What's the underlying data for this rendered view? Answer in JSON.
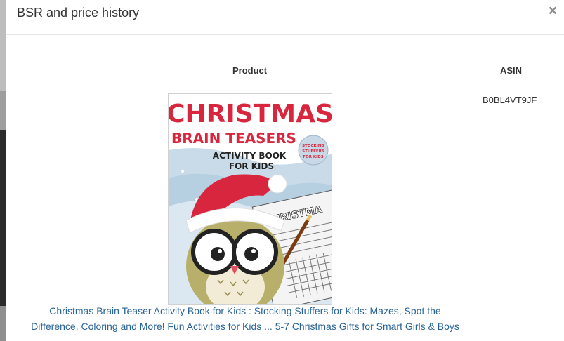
{
  "modal": {
    "title": "BSR and price history",
    "close_label": "×"
  },
  "table": {
    "headers": [
      "Product",
      "ASIN"
    ],
    "rows": [
      {
        "asin": "B0BL4VT9JF",
        "product_title": "Christmas Brain Teaser Activity Book for Kids : Stocking Stuffers for Kids: Mazes, Spot the Difference, Coloring and More! Fun Activities for Kids ... 5-7 Christmas Gifts for Smart Girls & Boys",
        "cover": {
          "title_line1": "CHRISTMAS",
          "title_line2": "BRAIN TEASERS",
          "subtitle_line1": "ACTIVITY BOOK",
          "subtitle_line2": "FOR KIDS",
          "badge_line1": "STOCKING",
          "badge_line2": "STUFFERS",
          "badge_line3": "FOR KIDS",
          "page_word": "CHRISTMA"
        }
      }
    ]
  }
}
